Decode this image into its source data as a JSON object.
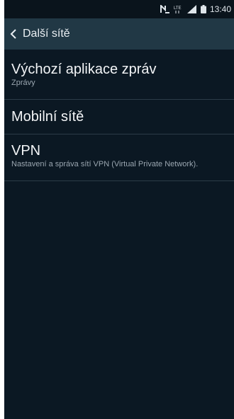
{
  "status_bar": {
    "network_label": "LTE",
    "clock": "13:40",
    "icons": [
      "nfc-icon",
      "lte-icon",
      "signal-icon",
      "battery-icon"
    ]
  },
  "action_bar": {
    "title": "Další sítě",
    "back_icon": "chevron-left-icon"
  },
  "items": [
    {
      "title": "Výchozí aplikace zpráv",
      "subtitle": "Zprávy"
    },
    {
      "title": "Mobilní sítě",
      "subtitle": ""
    },
    {
      "title": "VPN",
      "subtitle": "Nastavení a správa sítí VPN (Virtual Private Network)."
    }
  ],
  "colors": {
    "background": "#0b1823",
    "action_bar": "#213845",
    "divider": "#2c3c48"
  }
}
